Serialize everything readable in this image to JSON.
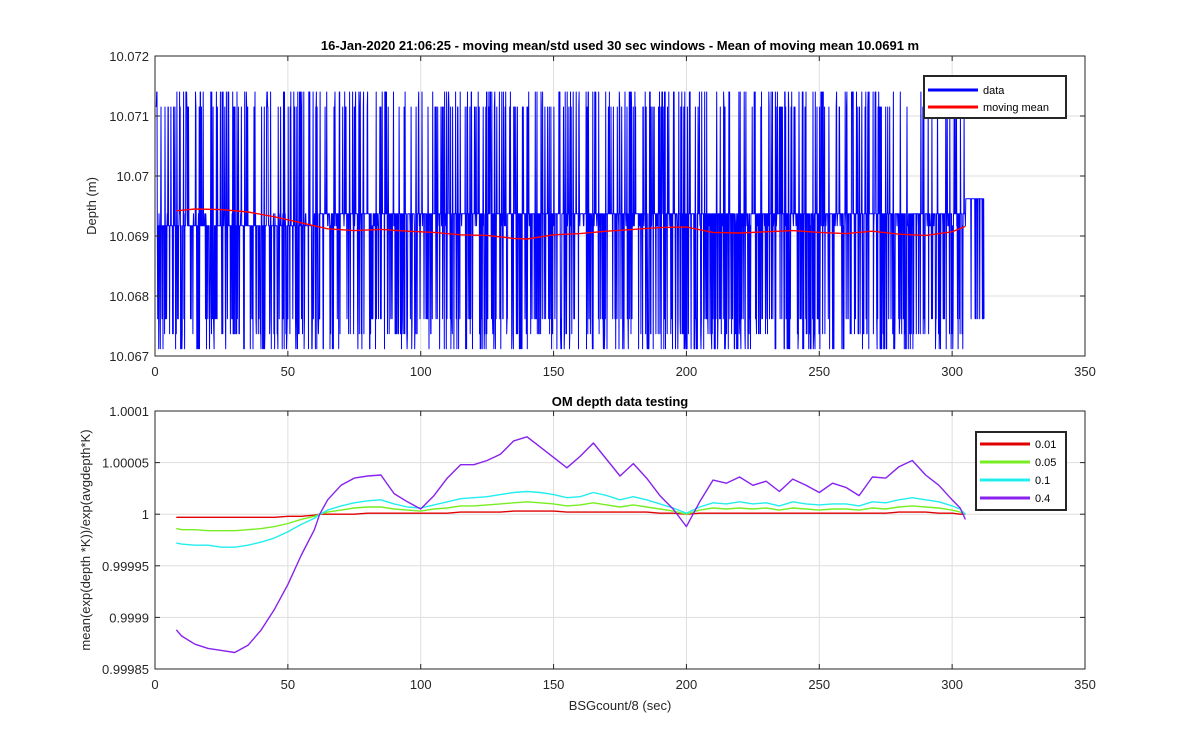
{
  "chart_data": [
    {
      "type": "line",
      "title": "16-Jan-2020 21:06:25 - moving mean/std used 30 sec windows - Mean of moving mean 10.0691 m",
      "xlabel": "",
      "ylabel": "Depth (m)",
      "xlim": [
        0,
        350
      ],
      "ylim": [
        10.067,
        10.072
      ],
      "xticks": [
        0,
        50,
        100,
        150,
        200,
        250,
        300,
        350
      ],
      "xtick_labels": [
        "0",
        "50",
        "100",
        "150",
        "200",
        "250",
        "300",
        "350"
      ],
      "yticks": [
        10.067,
        10.068,
        10.069,
        10.07,
        10.071,
        10.072
      ],
      "ytick_labels": [
        "10.067",
        "10.068",
        "10.069",
        "10.07",
        "10.071",
        "10.072"
      ],
      "grid": true,
      "legend_position": "top-right",
      "series": [
        {
          "name": "data",
          "color": "#0000ff",
          "style": "noisy-quantized",
          "x_range": [
            0.5,
            312
          ],
          "levels": [
            10.06712,
            10.06737,
            10.06762,
            10.06917,
            10.06937,
            10.07115,
            10.0714
          ],
          "base_level_left": 10.06917,
          "base_level_right": 10.06937,
          "switch_x": 60,
          "end_level": 10.06962
        },
        {
          "name": "moving mean",
          "color": "#ff0000",
          "x": [
            8,
            15,
            25,
            35,
            45,
            55,
            65,
            75,
            85,
            95,
            105,
            115,
            125,
            135,
            140,
            150,
            160,
            170,
            180,
            190,
            200,
            210,
            220,
            230,
            240,
            250,
            260,
            270,
            280,
            290,
            300,
            305
          ],
          "y": [
            10.06942,
            10.06945,
            10.06944,
            10.0694,
            10.06932,
            10.06922,
            10.06912,
            10.06909,
            10.06911,
            10.06908,
            10.06906,
            10.06902,
            10.06901,
            10.06896,
            10.06895,
            10.06902,
            10.06904,
            10.06908,
            10.06911,
            10.06914,
            10.06915,
            10.06906,
            10.06905,
            10.06907,
            10.06909,
            10.06906,
            10.06904,
            10.06908,
            10.06903,
            10.06901,
            10.06907,
            10.06916
          ]
        }
      ]
    },
    {
      "type": "line",
      "title": "OM depth data testing",
      "xlabel": "BSGcount/8 (sec)",
      "ylabel": "mean(exp(depth *K))/exp(avgdepth*K)",
      "xlim": [
        0,
        350
      ],
      "ylim": [
        0.99985,
        1.0001
      ],
      "xticks": [
        0,
        50,
        100,
        150,
        200,
        250,
        300,
        350
      ],
      "xtick_labels": [
        "0",
        "50",
        "100",
        "150",
        "200",
        "250",
        "300",
        "350"
      ],
      "yticks": [
        0.99985,
        0.9999,
        0.99995,
        1,
        1.00005,
        1.0001
      ],
      "ytick_labels": [
        "0.99985",
        "0.9999",
        "0.99995",
        "1",
        "1.00005",
        "1.0001"
      ],
      "grid": true,
      "legend_position": "top-right",
      "x": [
        8,
        10,
        15,
        20,
        25,
        30,
        35,
        40,
        45,
        50,
        55,
        60,
        62,
        65,
        70,
        75,
        80,
        85,
        90,
        95,
        100,
        105,
        110,
        115,
        120,
        125,
        130,
        135,
        140,
        145,
        150,
        155,
        160,
        165,
        170,
        175,
        180,
        185,
        190,
        195,
        200,
        205,
        210,
        215,
        220,
        225,
        230,
        235,
        240,
        245,
        250,
        255,
        260,
        265,
        270,
        275,
        280,
        285,
        290,
        295,
        300,
        303,
        305
      ],
      "series": [
        {
          "name": "0.01",
          "color": "#e00000",
          "y": [
            0.999997,
            0.999997,
            0.999997,
            0.999997,
            0.999997,
            0.999997,
            0.999997,
            0.999997,
            0.999997,
            0.999998,
            0.999998,
            0.999999,
            1.0,
            1.0,
            1.0,
            1.0,
            1.000001,
            1.000001,
            1.000001,
            1.000001,
            1.000001,
            1.000001,
            1.000001,
            1.000002,
            1.000002,
            1.000002,
            1.000002,
            1.000003,
            1.000003,
            1.000003,
            1.000003,
            1.000002,
            1.000002,
            1.000002,
            1.000002,
            1.000002,
            1.000002,
            1.000002,
            1.000001,
            1.000001,
            1.0,
            1.000001,
            1.000001,
            1.000001,
            1.000001,
            1.000001,
            1.000001,
            1.000001,
            1.000001,
            1.000001,
            1.000001,
            1.000001,
            1.000001,
            1.000001,
            1.000001,
            1.000001,
            1.000002,
            1.000002,
            1.000002,
            1.000001,
            1.000001,
            1.0,
            1.0
          ]
        },
        {
          "name": "0.05",
          "color": "#77ee22",
          "y": [
            0.999986,
            0.999985,
            0.999985,
            0.999984,
            0.999984,
            0.999984,
            0.999985,
            0.999986,
            0.999988,
            0.999991,
            0.999995,
            0.999998,
            1.0,
            1.000002,
            1.000004,
            1.000006,
            1.000007,
            1.000007,
            1.000005,
            1.000004,
            1.000003,
            1.000005,
            1.000006,
            1.000008,
            1.000008,
            1.000009,
            1.00001,
            1.000011,
            1.000012,
            1.000011,
            1.00001,
            1.000008,
            1.000009,
            1.000011,
            1.000009,
            1.000007,
            1.000009,
            1.000007,
            1.000005,
            1.000003,
            1.0,
            1.000004,
            1.000006,
            1.000005,
            1.000006,
            1.000005,
            1.000006,
            1.000004,
            1.000006,
            1.000005,
            1.000004,
            1.000005,
            1.000005,
            1.000004,
            1.000006,
            1.000005,
            1.000007,
            1.000008,
            1.000007,
            1.000006,
            1.000004,
            1.000002,
            1.0
          ]
        },
        {
          "name": "0.1",
          "color": "#22eeee",
          "y": [
            0.999972,
            0.999971,
            0.99997,
            0.99997,
            0.999968,
            0.999968,
            0.99997,
            0.999973,
            0.999977,
            0.999983,
            0.99999,
            0.999996,
            1.0,
            1.000004,
            1.000008,
            1.000011,
            1.000013,
            1.000014,
            1.00001,
            1.000007,
            1.000006,
            1.000009,
            1.000012,
            1.000015,
            1.000016,
            1.000017,
            1.000019,
            1.000021,
            1.000022,
            1.000021,
            1.000019,
            1.000016,
            1.000017,
            1.000021,
            1.000018,
            1.000014,
            1.000017,
            1.000014,
            1.00001,
            1.000006,
            1.000001,
            1.000007,
            1.000011,
            1.00001,
            1.000012,
            1.00001,
            1.000011,
            1.000008,
            1.000012,
            1.00001,
            1.000009,
            1.00001,
            1.00001,
            1.000008,
            1.000012,
            1.000011,
            1.000014,
            1.000016,
            1.000014,
            1.000012,
            1.000008,
            1.000005,
            1.0
          ]
        },
        {
          "name": "0.4",
          "color": "#8822ee",
          "y": [
            0.999888,
            0.999882,
            0.999874,
            0.99987,
            0.999868,
            0.999866,
            0.999873,
            0.999888,
            0.999908,
            0.999932,
            0.99996,
            0.999985,
            1.0,
            1.000014,
            1.000028,
            1.000035,
            1.000037,
            1.000038,
            1.00002,
            1.000012,
            1.000005,
            1.000018,
            1.000035,
            1.000048,
            1.000048,
            1.000052,
            1.000058,
            1.000071,
            1.000075,
            1.000065,
            1.000055,
            1.000045,
            1.000056,
            1.000069,
            1.000053,
            1.000037,
            1.000049,
            1.000035,
            1.000018,
            1.000005,
            0.999988,
            1.000012,
            1.000033,
            1.00003,
            1.000036,
            1.000028,
            1.000032,
            1.000022,
            1.000034,
            1.000028,
            1.000021,
            1.00003,
            1.000026,
            1.000018,
            1.000036,
            1.000035,
            1.000046,
            1.000052,
            1.000038,
            1.000028,
            1.000014,
            1.000006,
            0.999995
          ]
        }
      ]
    }
  ]
}
